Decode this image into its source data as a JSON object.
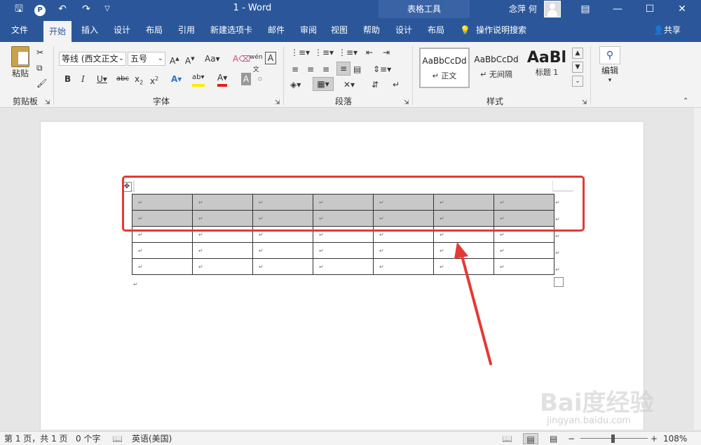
{
  "titlebar": {
    "doc_title": "1  -  Word",
    "context_tab": "表格工具",
    "user_name": "念萍 何",
    "qa_icons": [
      "save-icon",
      "p-icon",
      "undo-icon",
      "redo-icon",
      "customize-icon"
    ]
  },
  "tabs": [
    {
      "label": "文件"
    },
    {
      "label": "开始"
    },
    {
      "label": "插入"
    },
    {
      "label": "设计"
    },
    {
      "label": "布局"
    },
    {
      "label": "引用"
    },
    {
      "label": "新建选项卡"
    },
    {
      "label": "邮件"
    },
    {
      "label": "审阅"
    },
    {
      "label": "视图"
    },
    {
      "label": "帮助"
    },
    {
      "label": "设计"
    },
    {
      "label": "布局"
    }
  ],
  "search_label": "操作说明搜索",
  "share_label": "共享",
  "ribbon": {
    "clipboard": {
      "label": "剪贴板",
      "paste": "粘贴"
    },
    "font": {
      "label": "字体",
      "font_name": "等线 (西文正文",
      "font_size": "五号"
    },
    "paragraph": {
      "label": "段落"
    },
    "styles": {
      "label": "样式",
      "items": [
        {
          "sample": "AaBbCcDd",
          "name": "↵ 正文"
        },
        {
          "sample": "AaBbCcDd",
          "name": "↵ 无间隔"
        },
        {
          "sample": "AaBl",
          "name": "标题 1"
        }
      ]
    },
    "editing": {
      "label": "编辑"
    }
  },
  "statusbar": {
    "page_info": "第 1 页，共 1 页",
    "word_count": "0 个字",
    "language": "英语(美国)",
    "zoom": "108%"
  },
  "table": {
    "rows": 5,
    "cols": 7,
    "selected_rows": 2,
    "cell_mark": "↵"
  },
  "colors": {
    "accent": "#2b579a",
    "highlight": "#e53935"
  },
  "watermark": {
    "brand": "Bai度经验",
    "url": "jingyan.baidu.com"
  }
}
